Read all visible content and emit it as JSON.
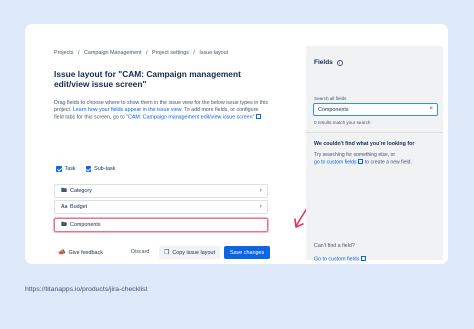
{
  "breadcrumb": [
    "Projects",
    "Campaign Management",
    "Project settings",
    "Issue layout"
  ],
  "breadcrumb_sep": "/",
  "page_title": "Issue layout for \"CAM: Campaign management edit/view issue screen\"",
  "description": {
    "line1": "Drag fields to choose where to show them in the issue view for the below issue types in this project.",
    "link1": "Learn how your fields appear in the issue view.",
    "line2": "To add more fields, or configure field tabs for this screen, go to",
    "link2": "\"CAM: Campaign management edit/view issue screen\""
  },
  "issue_types": [
    {
      "label": "Task",
      "icon": "checkbox-icon"
    },
    {
      "label": "Sub-task",
      "icon": "subtask-icon"
    }
  ],
  "sections": [
    {
      "label": "Category",
      "icon": "folder-icon",
      "highlighted": false
    },
    {
      "label": "Budget",
      "icon": "text-field-icon",
      "icon_glyph": "Aa",
      "highlighted": false
    },
    {
      "label": "Components",
      "icon": "folder-icon",
      "highlighted": true
    }
  ],
  "footer": {
    "feedback": "Give feedback",
    "discard": "Discard",
    "copy": "Copy issue layout",
    "save": "Save changes"
  },
  "fields_panel": {
    "title": "Fields",
    "search_label": "Search all fields",
    "search_value": "Components",
    "match_text": "0 results match your search",
    "not_found_title": "We couldn't find what you're looking for",
    "not_found_desc": "Try searching for something else, or",
    "not_found_link": "go to custom fields",
    "not_found_tail": "to create a new field.",
    "cant_find": "Can't find a field?",
    "goto_custom": "Go to custom fields"
  },
  "source_url": "https://titanapps.io/products/jira-checklist",
  "colors": {
    "accent": "#0c66e4",
    "highlight_border": "#e8748a",
    "arrow": "#e8335e",
    "background": "#dde8f8"
  }
}
